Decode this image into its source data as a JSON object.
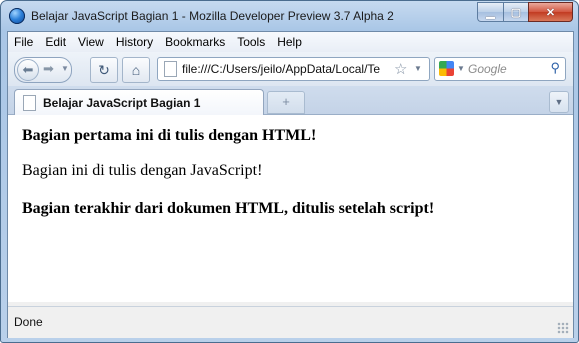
{
  "window": {
    "title": "Belajar JavaScript Bagian 1 - Mozilla Developer Preview 3.7 Alpha 2",
    "buttons": {
      "minimize": "▁",
      "maximize": "▢",
      "close": "✕"
    }
  },
  "menubar": {
    "items": [
      "File",
      "Edit",
      "View",
      "History",
      "Bookmarks",
      "Tools",
      "Help"
    ]
  },
  "navbar": {
    "back": "⬅",
    "forward": "➡",
    "reload": "↻",
    "home": "⌂",
    "url": "file:///C:/Users/jeilo/AppData/Local/Te",
    "star": "☆",
    "dropdown": "▼",
    "search_placeholder": "Google",
    "search_glyph": "⚲"
  },
  "tabs": {
    "active_label": "Belajar JavaScript Bagian 1",
    "new_tab": "+",
    "list": "▼"
  },
  "content": {
    "paragraph1": "Bagian pertama ini di tulis dengan HTML!",
    "paragraph2": "Bagian ini di tulis dengan JavaScript!",
    "paragraph3": "Bagian terakhir dari dokumen HTML, ditulis setelah script!"
  },
  "status": {
    "text": "Done"
  }
}
